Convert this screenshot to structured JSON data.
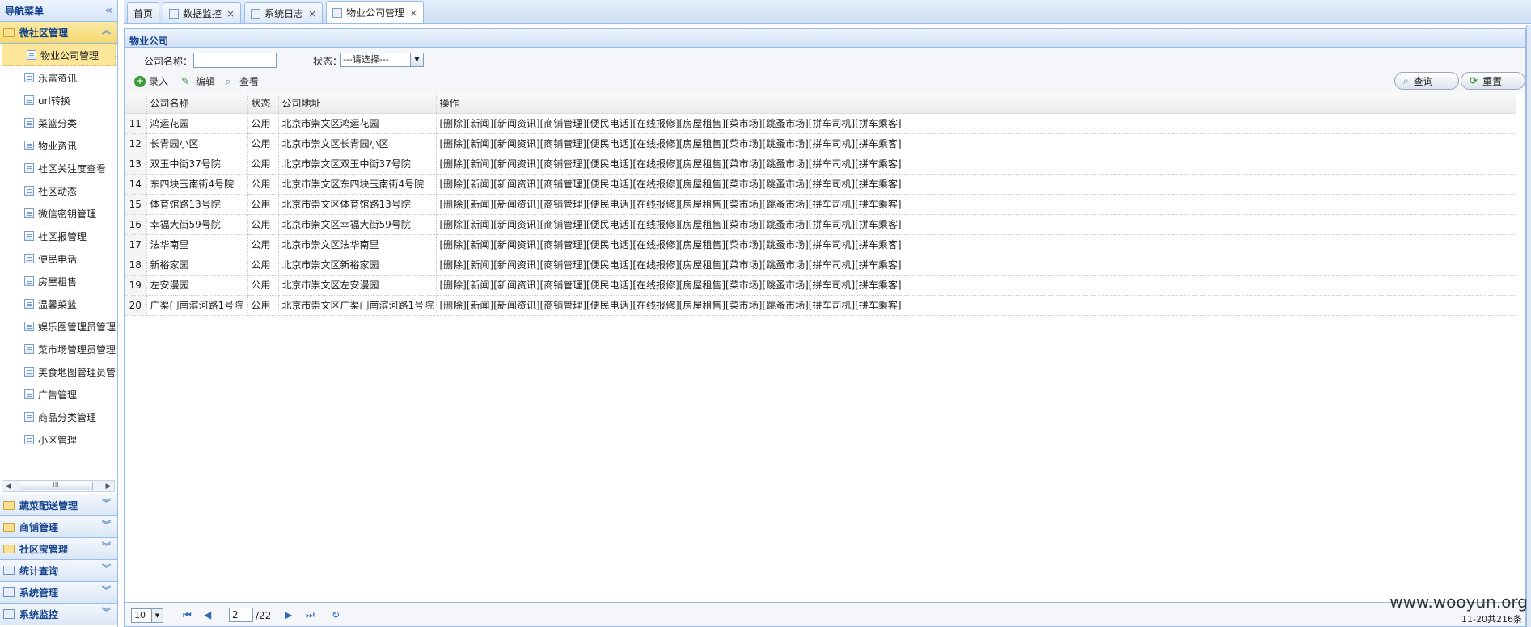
{
  "nav": {
    "title": "导航菜单",
    "open_group": "微社区管理",
    "items": [
      "物业公司管理",
      "乐富资讯",
      "url转换",
      "菜篮分类",
      "物业资讯",
      "社区关注度查看",
      "社区动态",
      "微信密钥管理",
      "社区报管理",
      "便民电话",
      "房屋租售",
      "温馨菜篮",
      "娱乐圈管理员管理",
      "菜市场管理员管理",
      "美食地图管理员管",
      "广告管理",
      "商品分类管理",
      "小区管理"
    ],
    "other_groups": [
      "蔬菜配送管理",
      "商铺管理",
      "社区宝管理",
      "统计查询",
      "系统管理",
      "系统监控"
    ]
  },
  "tabs": [
    "首页",
    "数据监控",
    "系统日志",
    "物业公司管理"
  ],
  "panel_title": "物业公司",
  "filter": {
    "company_label": "公司名称：",
    "status_label": "状态：",
    "status_value": "---请选择---"
  },
  "toolbar": {
    "add": "录入",
    "edit": "编辑",
    "view": "查看",
    "query": "查询",
    "reset": "重置"
  },
  "grid": {
    "columns": [
      "公司名称",
      "状态",
      "公司地址",
      "操作"
    ],
    "rows": [
      {
        "num": "11",
        "name": "鸿运花园",
        "status": "公用",
        "address": "北京市崇文区鸿运花园"
      },
      {
        "num": "12",
        "name": "长青园小区",
        "status": "公用",
        "address": "北京市崇文区长青园小区"
      },
      {
        "num": "13",
        "name": "双玉中街37号院",
        "status": "公用",
        "address": "北京市崇文区双玉中街37号院"
      },
      {
        "num": "14",
        "name": "东四块玉南街4号院",
        "status": "公用",
        "address": "北京市崇文区东四块玉南街4号院"
      },
      {
        "num": "15",
        "name": "体育馆路13号院",
        "status": "公用",
        "address": "北京市崇文区体育馆路13号院"
      },
      {
        "num": "16",
        "name": "幸福大街59号院",
        "status": "公用",
        "address": "北京市崇文区幸福大街59号院"
      },
      {
        "num": "17",
        "name": "法华南里",
        "status": "公用",
        "address": "北京市崇文区法华南里"
      },
      {
        "num": "18",
        "name": "新裕家园",
        "status": "公用",
        "address": "北京市崇文区新裕家园"
      },
      {
        "num": "19",
        "name": "左安漫园",
        "status": "公用",
        "address": "北京市崇文区左安漫园"
      },
      {
        "num": "20",
        "name": "广渠门南滨河路1号院",
        "status": "公用",
        "address": "北京市崇文区广渠门南滨河路1号院"
      }
    ],
    "actions": "[删除][新闻][新闻资讯][商铺管理][便民电话][在线报修][房屋租售][菜市场][跳蚤市场][拼车司机][拼车乘客]"
  },
  "pager": {
    "page_size": "10",
    "current": "2",
    "total": "/22",
    "info": "11-20共216条"
  },
  "watermark": "www.wooyun.org"
}
